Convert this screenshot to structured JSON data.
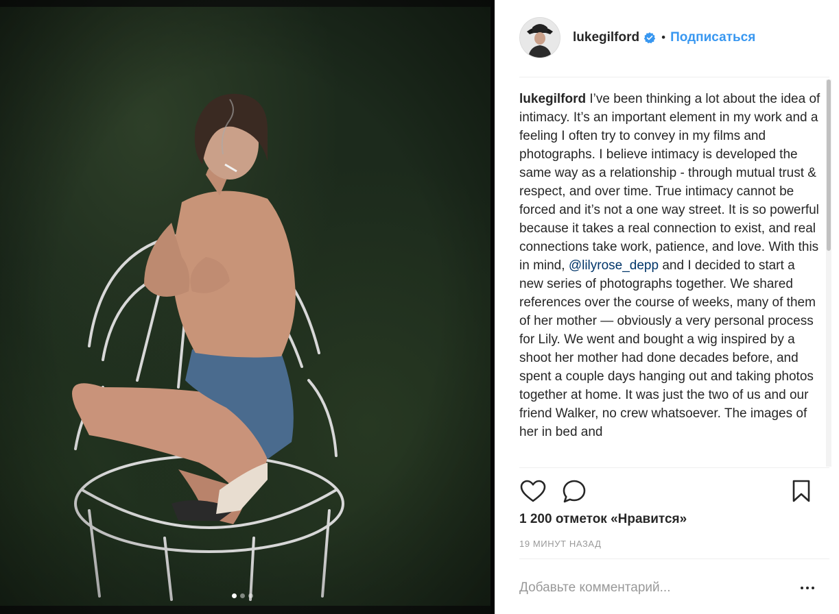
{
  "post": {
    "username": "lukegilford",
    "follow_label": "Подписаться",
    "separator": "•",
    "caption_user": "lukegilford",
    "caption_part1": " I’ve been thinking a lot about the idea of intimacy. It’s an important element in my work and a feeling I often try to convey in my films and photographs. I believe intimacy is developed the same way as a relationship - through mutual trust & respect, and over time. True intimacy cannot be forced and it’s not a one way street. It is so powerful because it takes a real connection to exist, and real connections take work, patience, and love. With this in mind, ",
    "caption_mention": "@lilyrose_depp",
    "caption_part2": " and I decided to start a new series of photographs together. We shared references over the course of weeks, many of them of her mother — obviously a very personal process for Lily. We went and bought a wig inspired by a shoot her mother had done decades before, and spent a couple days hanging out and taking photos together at home. It was just the two of us and our friend Walker, no crew whatsoever. The images of her in bed and",
    "likes_text": "1 200 отметок «Нравится»",
    "timestamp": "19 МИНУТ НАЗАД",
    "comment_placeholder": "Добавьте комментарий..."
  },
  "carousel": {
    "total": 3,
    "active_index": 0
  },
  "icons": {
    "verified": "verified-badge-icon",
    "like": "heart-icon",
    "comment": "comment-bubble-icon",
    "save": "bookmark-icon",
    "more": "more-options-icon"
  },
  "colors": {
    "accent": "#3897f0",
    "verified": "#3897f0",
    "mention": "#003569",
    "text": "#262626",
    "muted": "#999999",
    "divider": "#efefef"
  }
}
